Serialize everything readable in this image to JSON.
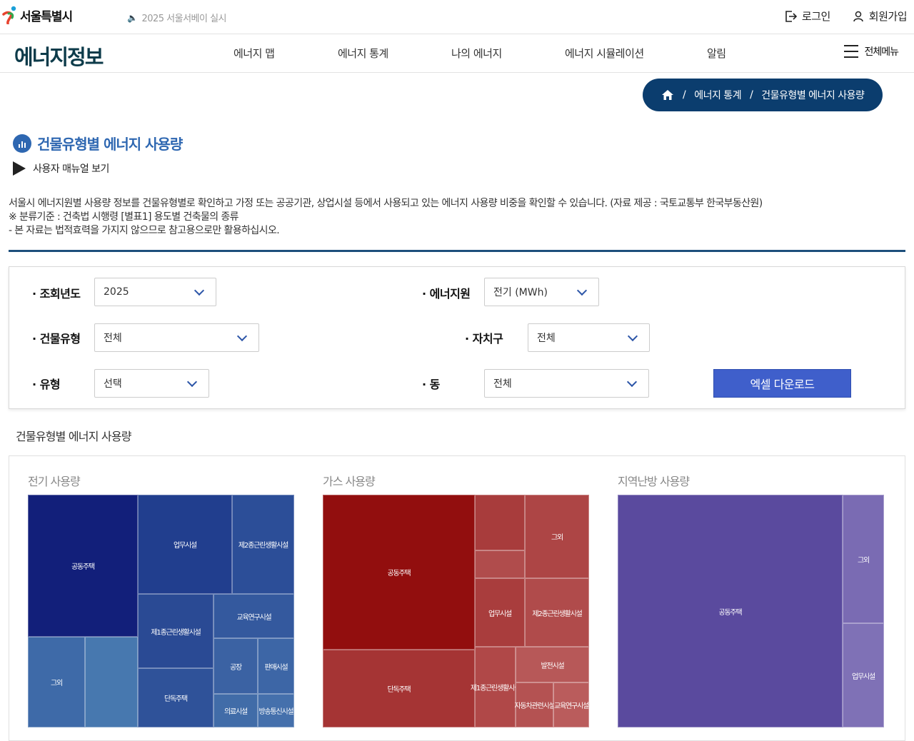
{
  "header": {
    "logo_text": "서울특별시",
    "notice": "2025 서울서베이 실시",
    "login": "로그인",
    "signup": "회원가입"
  },
  "nav": {
    "brand": "에너지정보",
    "items": [
      "에너지 맵",
      "에너지 통계",
      "나의 에너지",
      "에너지 시뮬레이션",
      "알림"
    ],
    "all_menu": "전체메뉴"
  },
  "breadcrumb": {
    "sep": "/",
    "level1": "에너지 통계",
    "level2": "건물유형별 에너지 사용량"
  },
  "page": {
    "title": "건물유형별 에너지 사용량",
    "manual_link": "사용자 매뉴얼 보기",
    "desc": [
      "서울시 에너지원별 사용량 정보를 건물유형별로 확인하고 가정 또는 공공기관, 상업시설 등에서 사용되고 있는 에너지 사용량 비중을 확인할 수 있습니다. (자료 제공 : 국토교통부 한국부동산원)",
      "※ 분류기준 : 건축법 시행령 [별표1] 용도별 건축물의 종류",
      "- 본 자료는 법적효력을 가지지 않으므로 참고용으로만 활용하십시오."
    ]
  },
  "filters": {
    "year": {
      "label": "· 조회년도",
      "value": "2025"
    },
    "energy": {
      "label": "· 에너지원",
      "value": "전기 (MWh)"
    },
    "building": {
      "label": "· 건물유형",
      "value": "전체"
    },
    "district": {
      "label": "· 자치구",
      "value": "전체"
    },
    "type": {
      "label": "· 유형",
      "value": "선택"
    },
    "dong": {
      "label": "· 동",
      "value": "전체"
    },
    "excel_button": "엑셀 다운로드"
  },
  "section_title": "건물유형별 에너지 사용량",
  "colors": {
    "electric_base": "#1f3b8f",
    "gas_base": "#9b1010",
    "district_heat_base": "#4f47a0",
    "button": "#3f5fcb",
    "breadcrumb": "#0b3d6e"
  },
  "charts": {
    "electric": {
      "title": "전기 사용량",
      "labels": [
        "공동주택",
        "업무시설",
        "제2종근린생활시설",
        "교육연구시설",
        "제1종근린생활시설",
        "그외",
        "공장",
        "판매시설",
        "단독주택",
        "의료시설",
        "방송통신시설"
      ]
    },
    "gas": {
      "title": "가스 사용량",
      "labels": [
        "공동주택",
        "그외",
        "업무시설",
        "제2종근린생활시설",
        "단독주택",
        "제1종근린생활시설",
        "발전시설",
        "자동차관련시설",
        "교육연구시설"
      ]
    },
    "district_heat": {
      "title": "지역난방 사용량",
      "labels": [
        "공동주택",
        "그외",
        "업무시설"
      ]
    }
  }
}
